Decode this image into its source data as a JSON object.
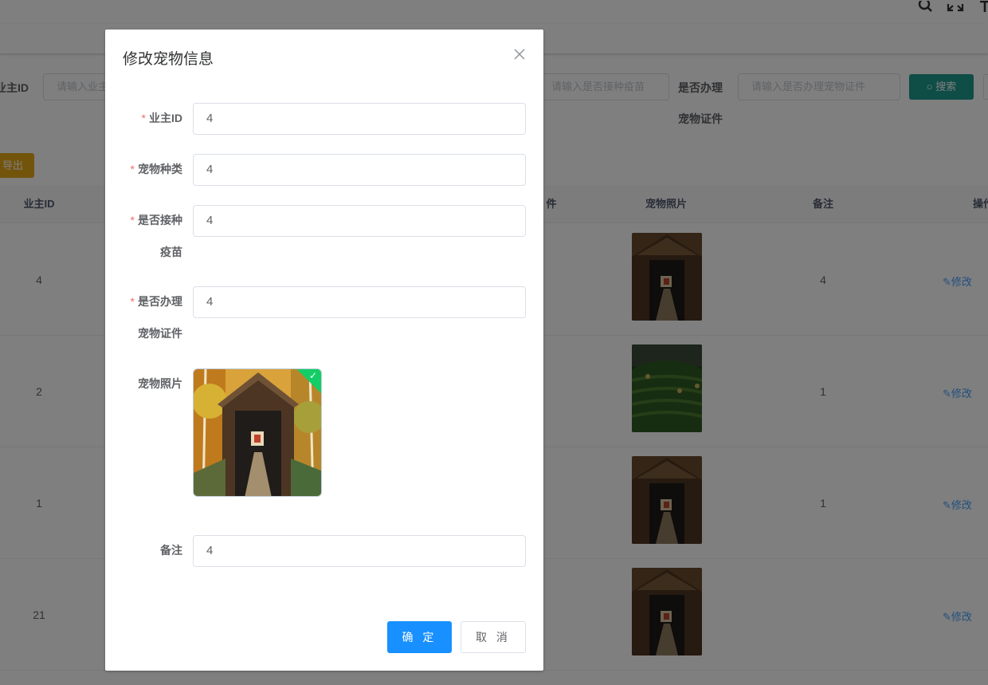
{
  "search": {
    "owner_label": "业主ID",
    "owner_placeholder": "请输入业主ID",
    "vaccine_placeholder": "请输入是否接种疫苗",
    "cert_label_1": "是否办理",
    "cert_label_2": "宠物证件",
    "cert_placeholder": "请输入是否办理宠物证件",
    "search_btn": "搜索"
  },
  "toolbar": {
    "export": "导出"
  },
  "table": {
    "headers": {
      "owner_id": "业主ID",
      "cert": "件",
      "photo": "宠物照片",
      "remark": "备注",
      "ops": "操作"
    },
    "rows": [
      {
        "owner_id": "4",
        "remark": "4",
        "edit": "修改"
      },
      {
        "owner_id": "2",
        "remark": "1",
        "edit": "修改"
      },
      {
        "owner_id": "1",
        "remark": "1",
        "edit": "修改"
      },
      {
        "owner_id": "21",
        "remark": "",
        "edit": "修改"
      }
    ]
  },
  "dialog": {
    "title": "修改宠物信息",
    "fields": {
      "owner_id": {
        "label": "业主ID",
        "value": "4"
      },
      "pet_type": {
        "label": "宠物种类",
        "value": "4"
      },
      "vaccine": {
        "label_1": "是否接种",
        "label_2": "疫苗",
        "value": "4"
      },
      "cert": {
        "label_1": "是否办理",
        "label_2": "宠物证件",
        "value": "4"
      },
      "photo": {
        "label": "宠物照片"
      },
      "remark": {
        "label": "备注",
        "value": "4"
      }
    },
    "confirm": "确 定",
    "cancel": "取 消"
  },
  "colors": {
    "primary": "#1890ff",
    "search": "#1f9a8e",
    "export": "#e6a817",
    "required": "#f56c6c",
    "success": "#13ce66"
  }
}
